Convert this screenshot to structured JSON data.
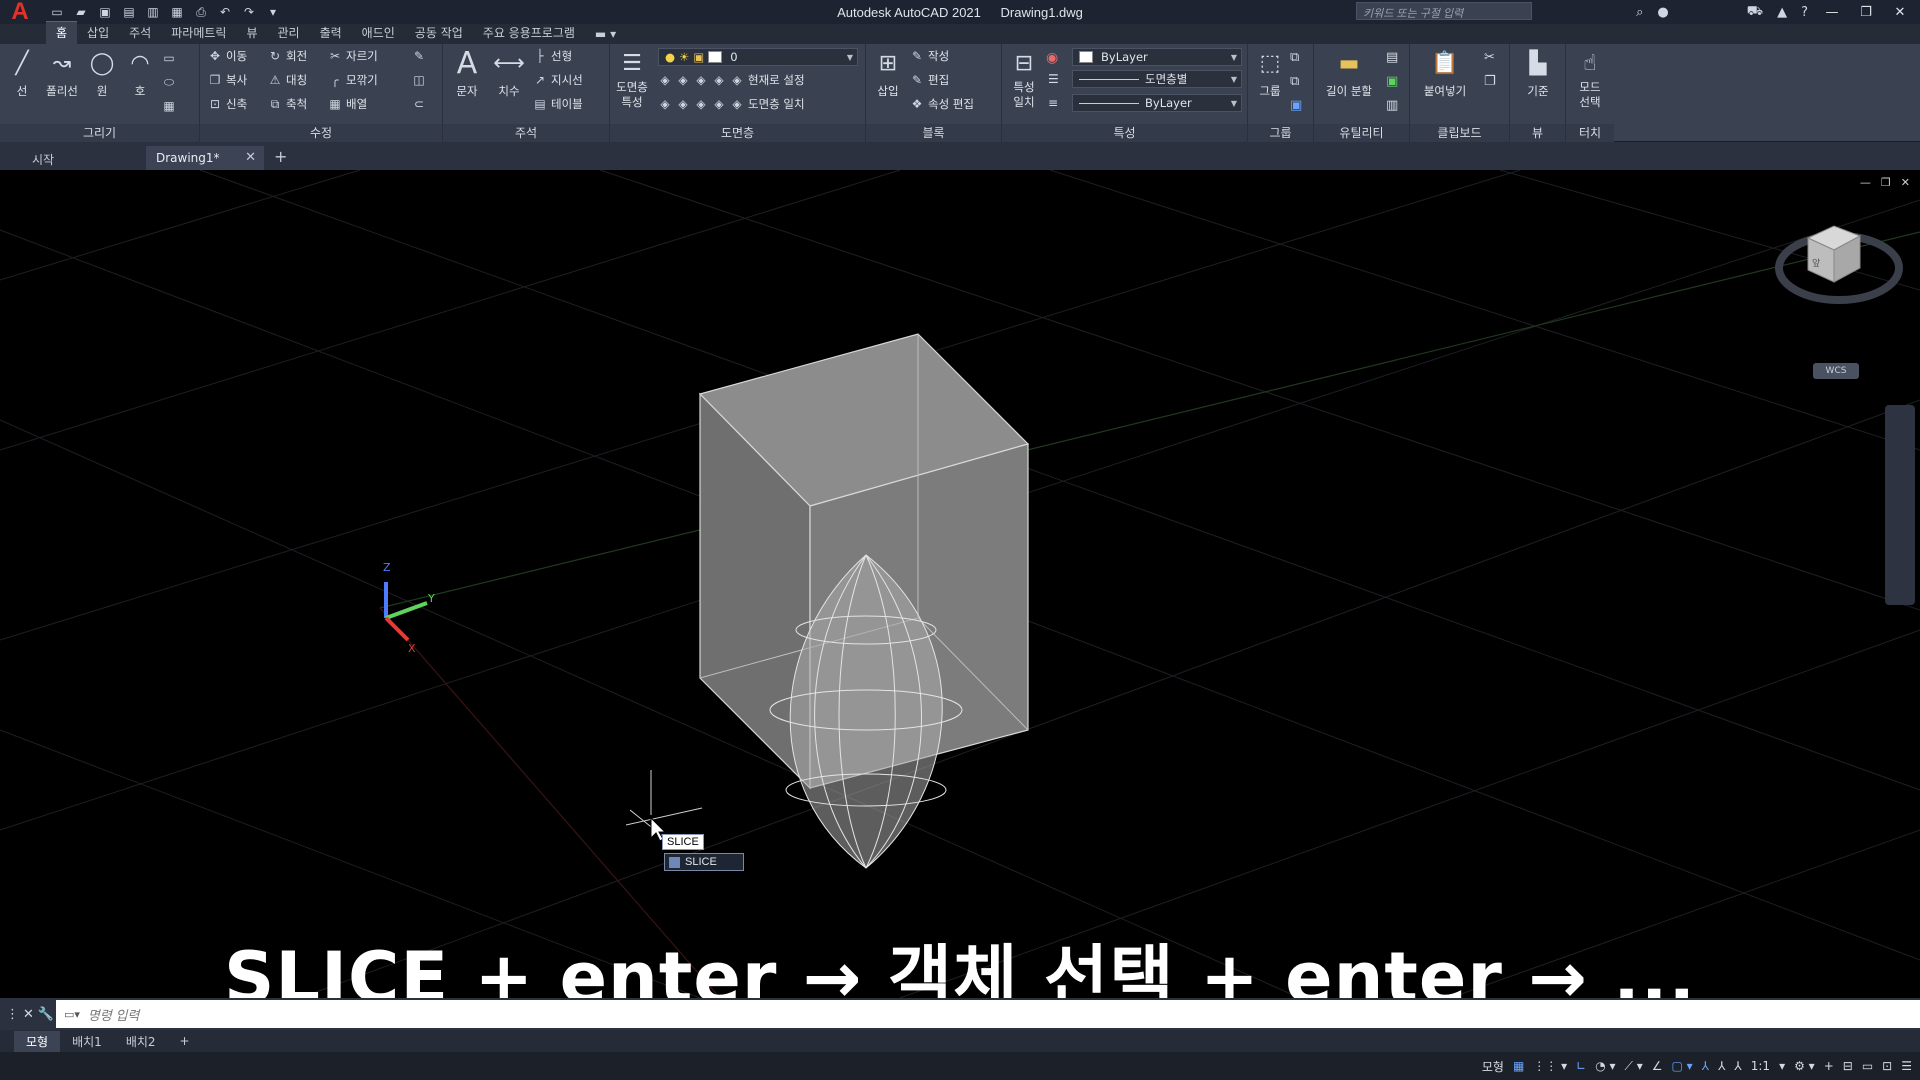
{
  "window": {
    "app_title": "Autodesk AutoCAD 2021",
    "file_name": "Drawing1.dwg",
    "search_placeholder": "키워드 또는 구절 입력"
  },
  "ribbon_tabs": [
    "홈",
    "삽입",
    "주석",
    "파라메트릭",
    "뷰",
    "관리",
    "출력",
    "애드인",
    "공동 작업",
    "주요 응용프로그램"
  ],
  "ribbon": {
    "draw": {
      "title": "그리기",
      "line": "선",
      "polyline": "폴리선",
      "circle": "원",
      "arc": "호"
    },
    "modify": {
      "title": "수정",
      "move": "이동",
      "rotate": "회전",
      "trim": "자르기",
      "copy": "복사",
      "mirror": "대칭",
      "fillet": "모깎기",
      "stretch": "신축",
      "scale": "축척",
      "array": "배열"
    },
    "annotation": {
      "title": "주석",
      "text": "문자",
      "dimension": "치수",
      "linear": "선형",
      "leader": "지시선",
      "table": "테이블"
    },
    "layers": {
      "title": "도면층",
      "layer_props": "도면층\n특성",
      "current_layer": "0",
      "set_current": "현재로 설정",
      "match_layer": "도면층 일치"
    },
    "block": {
      "title": "블록",
      "insert": "삽입",
      "create": "작성",
      "edit": "편집",
      "attr_edit": "속성 편집"
    },
    "properties": {
      "title": "특성",
      "match": "특성\n일치",
      "color": "ByLayer",
      "linetype": "도면층별",
      "lineweight": "ByLayer"
    },
    "groups": {
      "title": "그룹",
      "group": "그룹"
    },
    "utilities": {
      "title": "유틸리티",
      "measure": "길이 분할"
    },
    "clipboard": {
      "title": "클립보드",
      "paste": "붙여넣기"
    },
    "view": {
      "title": "뷰",
      "base": "기준"
    },
    "touch": {
      "title": "터치",
      "select_mode": "모드\n선택"
    }
  },
  "doc_tabs": {
    "start": "시작",
    "drawing": "Drawing1*"
  },
  "viewport": {
    "wcs_label": "WCS",
    "autocomplete_input": "SLICE",
    "autocomplete_item": "SLICE",
    "caption": "SLICE + enter → 객체 선택 + enter → ...",
    "viewcube_face": "앞"
  },
  "command_line": {
    "placeholder": "명령 입력"
  },
  "layout_tabs": [
    "모형",
    "배치1",
    "배치2"
  ],
  "statusbar": {
    "model": "모형",
    "scale": "1:1"
  },
  "colors": {
    "background": "#000000",
    "ribbon": "#3a4252",
    "accent_red": "#e2332b",
    "axis_x": "#e03c3c",
    "axis_y": "#5fd35f",
    "axis_z": "#4f7bff"
  }
}
